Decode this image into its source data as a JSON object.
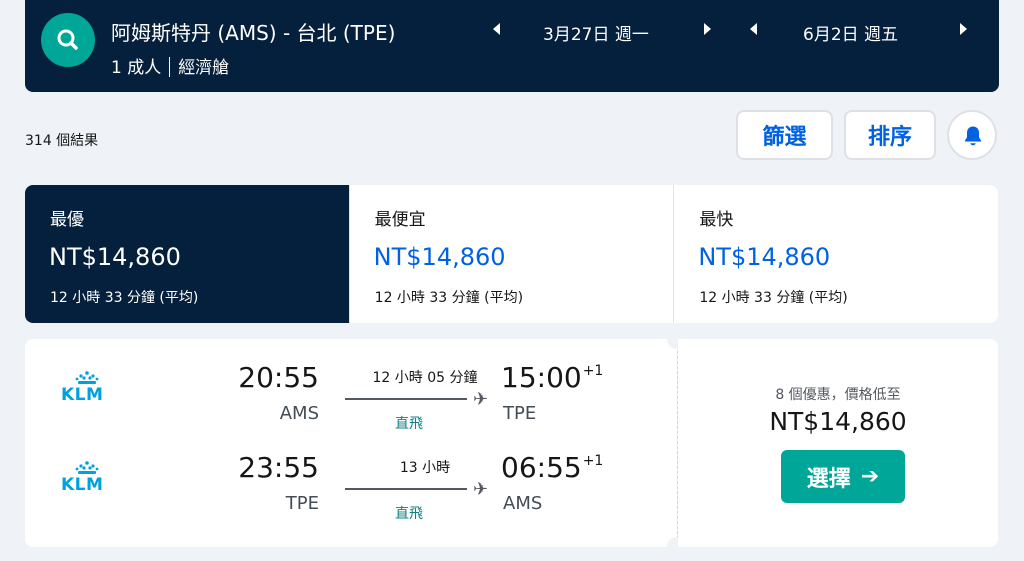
{
  "search": {
    "route": "阿姆斯特丹 (AMS) - 台北 (TPE)",
    "passengers": "1 成人",
    "cabin": "經濟艙",
    "depart_date": "3月27日 週一",
    "return_date": "6月2日 週五"
  },
  "toolbar": {
    "results": "314 個結果",
    "filter_label": "篩選",
    "sort_label": "排序"
  },
  "sort_tabs": [
    {
      "label": "最優",
      "price": "NT$14,860",
      "duration": "12 小時 33 分鐘 (平均)",
      "active": true
    },
    {
      "label": "最便宜",
      "price": "NT$14,860",
      "duration": "12 小時 33 分鐘 (平均)",
      "active": false
    },
    {
      "label": "最快",
      "price": "NT$14,860",
      "duration": "12 小時 33 分鐘 (平均)",
      "active": false
    }
  ],
  "result": {
    "legs": [
      {
        "airline": "KLM",
        "dep_time": "20:55",
        "dep_code": "AMS",
        "duration": "12 小時 05 分鐘",
        "stops": "直飛",
        "arr_time": "15:00",
        "arr_offset": "+1",
        "arr_code": "TPE"
      },
      {
        "airline": "KLM",
        "dep_time": "23:55",
        "dep_code": "TPE",
        "duration": "13 小時",
        "stops": "直飛",
        "arr_time": "06:55",
        "arr_offset": "+1",
        "arr_code": "AMS"
      }
    ],
    "deals": "8 個優惠，價格低至",
    "price": "NT$14,860",
    "select_label": "選擇"
  },
  "icons": {
    "search": "search-icon",
    "bell": "bell-icon",
    "plane": "plane-icon",
    "airline_logo": "klm-logo"
  },
  "colors": {
    "header_bg": "#05203c",
    "accent_teal": "#00a698",
    "link_blue": "#0062e3",
    "stops_teal": "#0c838a"
  }
}
